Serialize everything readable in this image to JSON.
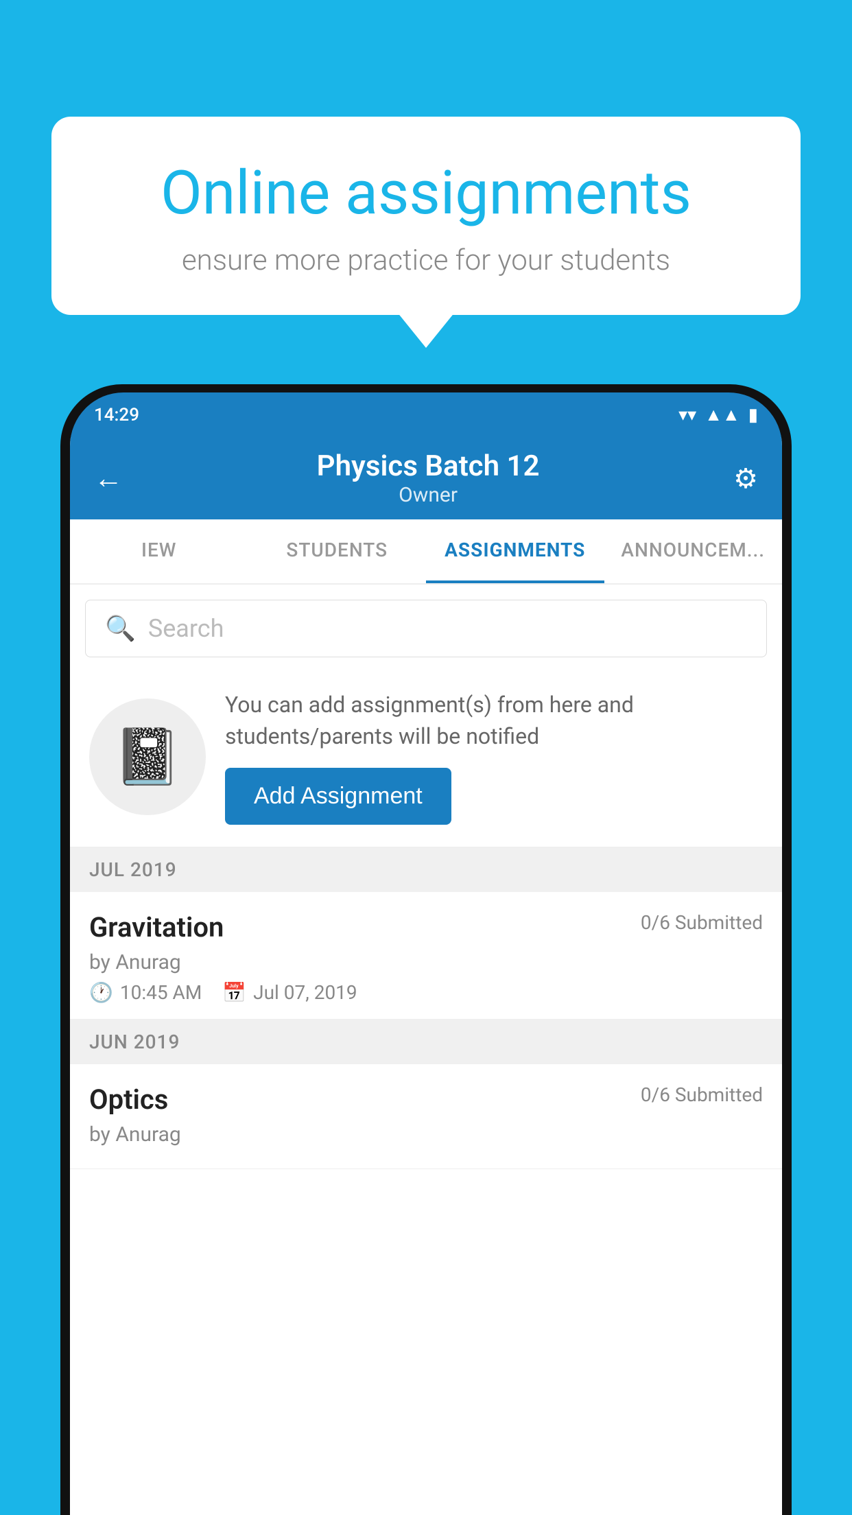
{
  "background": {
    "color": "#1ab5e8"
  },
  "speech_bubble": {
    "title": "Online assignments",
    "subtitle": "ensure more practice for your students"
  },
  "phone": {
    "status_bar": {
      "time": "14:29",
      "icons": [
        "wifi",
        "signal",
        "battery"
      ]
    },
    "header": {
      "title": "Physics Batch 12",
      "subtitle": "Owner",
      "back_label": "←",
      "settings_label": "⚙"
    },
    "tabs": [
      {
        "label": "IEW",
        "active": false
      },
      {
        "label": "STUDENTS",
        "active": false
      },
      {
        "label": "ASSIGNMENTS",
        "active": true
      },
      {
        "label": "ANNOUNCEM...",
        "active": false
      }
    ],
    "search": {
      "placeholder": "Search"
    },
    "add_assignment_card": {
      "description": "You can add assignment(s) from here and students/parents will be notified",
      "button_label": "Add Assignment"
    },
    "sections": [
      {
        "month": "JUL 2019",
        "assignments": [
          {
            "title": "Gravitation",
            "submitted": "0/6 Submitted",
            "by": "by Anurag",
            "time": "10:45 AM",
            "date": "Jul 07, 2019"
          }
        ]
      },
      {
        "month": "JUN 2019",
        "assignments": [
          {
            "title": "Optics",
            "submitted": "0/6 Submitted",
            "by": "by Anurag",
            "time": "",
            "date": ""
          }
        ]
      }
    ]
  }
}
